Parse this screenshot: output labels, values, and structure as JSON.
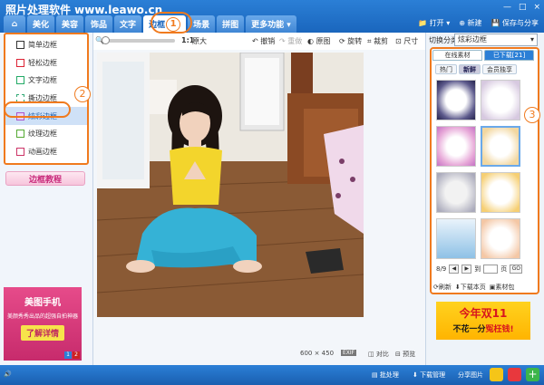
{
  "app": {
    "title": "照片处理软件 www.leawo.cn",
    "window_controls": [
      "—",
      "□",
      "×"
    ]
  },
  "tabs": [
    {
      "label": "⌂"
    },
    {
      "label": "美化"
    },
    {
      "label": "美容"
    },
    {
      "label": "饰品"
    },
    {
      "label": "文字"
    },
    {
      "label": "边框"
    },
    {
      "label": "场景"
    },
    {
      "label": "拼图"
    },
    {
      "label": "更多功能 ▾"
    }
  ],
  "annotation_1": "1",
  "annotation_2": "2",
  "annotation_3": "3",
  "right_tools": {
    "open": "打开 ▾",
    "new": "新建",
    "save": "保存与分享"
  },
  "border_list": [
    {
      "label": "简单边框"
    },
    {
      "label": "轻松边框"
    },
    {
      "label": "文字边框"
    },
    {
      "label": "撕边边框"
    },
    {
      "label": "炫彩边框"
    },
    {
      "label": "纹理边框"
    },
    {
      "label": "动画边框"
    }
  ],
  "tutorial_button": "边框教程",
  "ad_left": {
    "title": "美图手机",
    "subtitle": "美颜秀秀出品的超强自拍神器",
    "button": "了解详情",
    "pages": [
      "1",
      "2"
    ]
  },
  "toolbar": {
    "ratio": "1:1",
    "original_size": "原大",
    "undo": "撤销",
    "redo": "重做",
    "original": "原图",
    "rotate": "旋转",
    "crop": "裁剪",
    "size": "尺寸"
  },
  "canvas_status": {
    "dimensions": "600 × 450",
    "exif": "EXIF",
    "compare": "对比",
    "preview": "预览"
  },
  "material_panel": {
    "category_label": "切换分类",
    "category_value": "炫彩边框",
    "tabs": [
      "在线素材",
      "已下载[21]"
    ],
    "subtabs": [
      "热门",
      "新鲜",
      "会员独享"
    ],
    "page_info": "8/9",
    "goto_prefix": "到",
    "goto_suffix": "页",
    "go": "GO",
    "refresh": "刷新",
    "download_page": "下载本页",
    "material_pack": "素材包"
  },
  "ad_right": {
    "line1": "今年双11",
    "line2a": "不花一分",
    "line2b": "冤枉钱!"
  },
  "statusbar": {
    "batch": "批处理",
    "download_manager": "下载管理",
    "share": "分享图片"
  },
  "colors": {
    "accent_blue": "#2b7fd6",
    "annotation_orange": "#f07a1e"
  }
}
